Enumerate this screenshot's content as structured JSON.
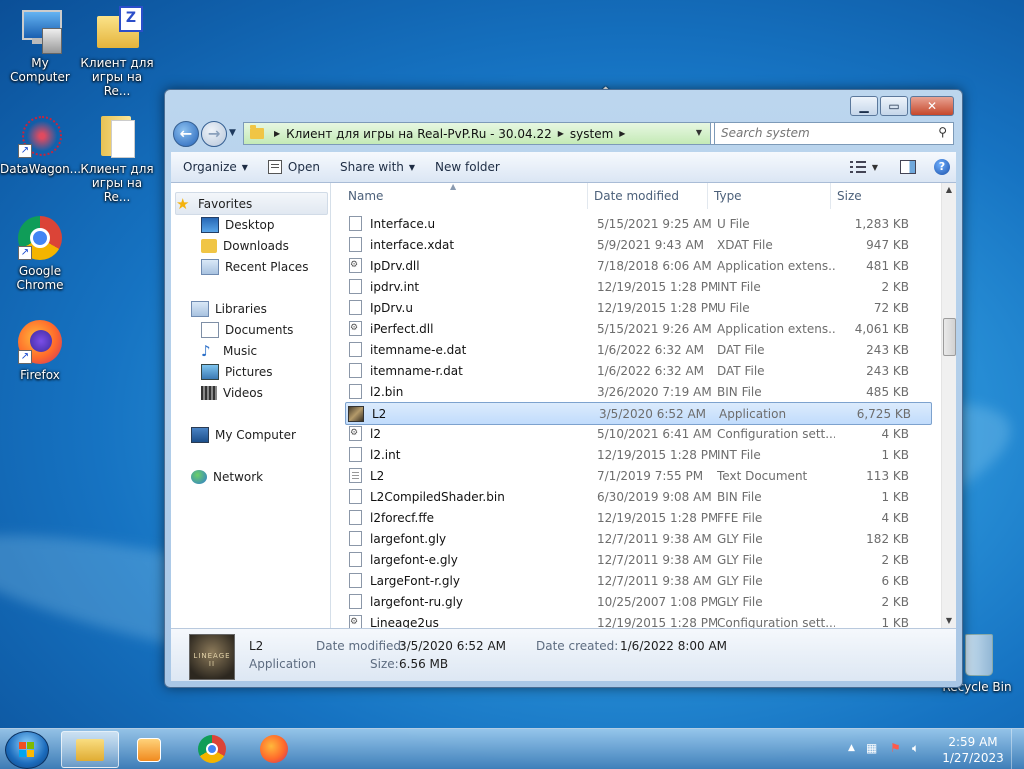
{
  "desktop": {
    "icons": [
      {
        "label": "My Computer"
      },
      {
        "label": "Клиент для игры на Re..."
      },
      {
        "label": "DataWagon..."
      },
      {
        "label": "Клиент для игры на Re..."
      },
      {
        "label": "Google Chrome"
      },
      {
        "label": "Firefox"
      },
      {
        "label": "Recycle Bin"
      }
    ]
  },
  "explorer": {
    "address": {
      "crumbs": [
        "Клиент для игры на Real-PvP.Ru - 30.04.22",
        "system"
      ]
    },
    "search": {
      "placeholder": "Search system"
    },
    "toolbar": {
      "organize": "Organize",
      "open": "Open",
      "share_with": "Share with",
      "new_folder": "New folder"
    },
    "nav": {
      "favorites": "Favorites",
      "desktop": "Desktop",
      "downloads": "Downloads",
      "recent_places": "Recent Places",
      "libraries": "Libraries",
      "documents": "Documents",
      "music": "Music",
      "pictures": "Pictures",
      "videos": "Videos",
      "my_computer": "My Computer",
      "network": "Network"
    },
    "columns": {
      "name": "Name",
      "date": "Date modified",
      "type": "Type",
      "size": "Size"
    },
    "files": [
      {
        "name": "Interface.u",
        "date": "5/15/2021 9:25 AM",
        "type": "U File",
        "size": "1,283 KB",
        "icon": "file"
      },
      {
        "name": "interface.xdat",
        "date": "5/9/2021 9:43 AM",
        "type": "XDAT File",
        "size": "947 KB",
        "icon": "file"
      },
      {
        "name": "IpDrv.dll",
        "date": "7/18/2018 6:06 AM",
        "type": "Application extens...",
        "size": "481 KB",
        "icon": "dll"
      },
      {
        "name": "ipdrv.int",
        "date": "12/19/2015 1:28 PM",
        "type": "INT File",
        "size": "2 KB",
        "icon": "file"
      },
      {
        "name": "IpDrv.u",
        "date": "12/19/2015 1:28 PM",
        "type": "U File",
        "size": "72 KB",
        "icon": "file"
      },
      {
        "name": "iPerfect.dll",
        "date": "5/15/2021 9:26 AM",
        "type": "Application extens...",
        "size": "4,061 KB",
        "icon": "dll"
      },
      {
        "name": "itemname-e.dat",
        "date": "1/6/2022 6:32 AM",
        "type": "DAT File",
        "size": "243 KB",
        "icon": "file"
      },
      {
        "name": "itemname-r.dat",
        "date": "1/6/2022 6:32 AM",
        "type": "DAT File",
        "size": "243 KB",
        "icon": "file"
      },
      {
        "name": "l2.bin",
        "date": "3/26/2020 7:19 AM",
        "type": "BIN File",
        "size": "485 KB",
        "icon": "file"
      },
      {
        "name": "L2",
        "date": "3/5/2020 6:52 AM",
        "type": "Application",
        "size": "6,725 KB",
        "icon": "app",
        "selected": true
      },
      {
        "name": "l2",
        "date": "5/10/2021 6:41 AM",
        "type": "Configuration sett...",
        "size": "4 KB",
        "icon": "cfg"
      },
      {
        "name": "l2.int",
        "date": "12/19/2015 1:28 PM",
        "type": "INT File",
        "size": "1 KB",
        "icon": "file"
      },
      {
        "name": "L2",
        "date": "7/1/2019 7:55 PM",
        "type": "Text Document",
        "size": "113 KB",
        "icon": "txt"
      },
      {
        "name": "L2CompiledShader.bin",
        "date": "6/30/2019 9:08 AM",
        "type": "BIN File",
        "size": "1 KB",
        "icon": "file"
      },
      {
        "name": "l2forecf.ffe",
        "date": "12/19/2015 1:28 PM",
        "type": "FFE File",
        "size": "4 KB",
        "icon": "file"
      },
      {
        "name": "largefont.gly",
        "date": "12/7/2011 9:38 AM",
        "type": "GLY File",
        "size": "182 KB",
        "icon": "file"
      },
      {
        "name": "largefont-e.gly",
        "date": "12/7/2011 9:38 AM",
        "type": "GLY File",
        "size": "2 KB",
        "icon": "file"
      },
      {
        "name": "LargeFont-r.gly",
        "date": "12/7/2011 9:38 AM",
        "type": "GLY File",
        "size": "6 KB",
        "icon": "file"
      },
      {
        "name": "largefont-ru.gly",
        "date": "10/25/2007 1:08 PM",
        "type": "GLY File",
        "size": "2 KB",
        "icon": "file"
      },
      {
        "name": "Lineage2us",
        "date": "12/19/2015 1:28 PM",
        "type": "Configuration sett...",
        "size": "1 KB",
        "icon": "cfg"
      }
    ],
    "details": {
      "name": "L2",
      "type": "Application",
      "date_modified_label": "Date modified:",
      "date_modified": "3/5/2020 6:52 AM",
      "date_created_label": "Date created:",
      "date_created": "1/6/2022 8:00 AM",
      "size_label": "Size:",
      "size": "6.56 MB",
      "thumb_text": "LINEAGE II"
    }
  },
  "taskbar": {
    "time": "2:59 AM",
    "date": "1/27/2023"
  }
}
